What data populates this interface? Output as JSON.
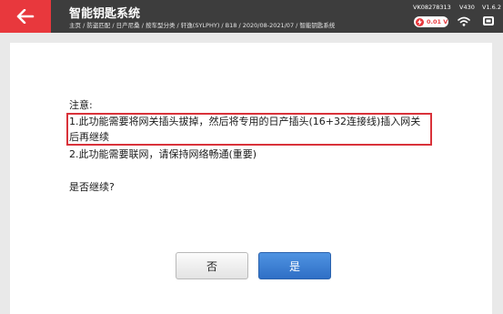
{
  "header": {
    "title": "智能钥匙系统",
    "breadcrumb": "主页 / 防盗匹配 / 日产尼桑 / 按车型分类 / 轩逸(SYLPHY) / B18 / 2020/08-2021/07 / 智能钥匙系统",
    "serial": "VK08278313",
    "model": "V430",
    "version": "V1.6.2",
    "voltage": "0.01 V"
  },
  "dialog": {
    "note_title": "注意:",
    "line1a": "1.此功能需要将网关插头拔掉，然后将专用的日产插头(16+32连接线)插入网关",
    "line1b": "后再继续",
    "line2": "2.此功能需要联网，请保持网络畅通(重要)",
    "question": "是否继续?",
    "no_label": "否",
    "yes_label": "是"
  },
  "colors": {
    "header_bg": "#3d3d3d",
    "accent_red": "#e8383d",
    "button_blue": "#3a7fd5",
    "page_bg": "#e9e9e9"
  }
}
